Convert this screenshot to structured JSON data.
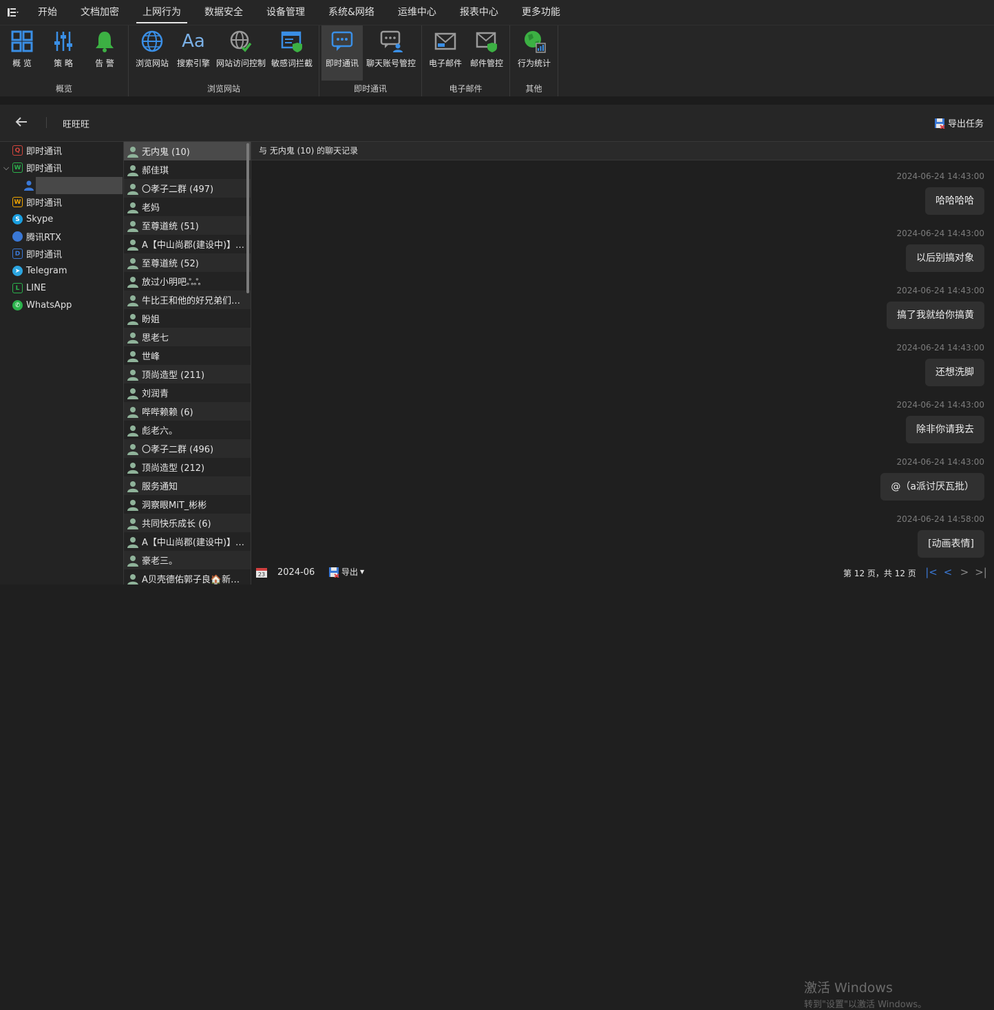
{
  "menubar": {
    "items": [
      "开始",
      "文档加密",
      "上网行为",
      "数据安全",
      "设备管理",
      "系统&网络",
      "运维中心",
      "报表中心",
      "更多功能"
    ],
    "active_index": 2
  },
  "ribbon": {
    "groups": [
      {
        "title": "概览",
        "buttons": [
          "概 览",
          "策 略",
          "告 警"
        ]
      },
      {
        "title": "浏览网站",
        "buttons": [
          "浏览网站",
          "搜索引擎",
          "网站访问控制",
          "敏感词拦截"
        ]
      },
      {
        "title": "即时通讯",
        "buttons": [
          "即时通讯",
          "聊天账号管控"
        ]
      },
      {
        "title": "电子邮件",
        "buttons": [
          "电子邮件",
          "邮件管控"
        ]
      },
      {
        "title": "其他",
        "buttons": [
          "行为统计"
        ]
      }
    ],
    "icon_glyph": "Aa"
  },
  "header": {
    "title": "旺旺旺",
    "export_task": "导出任务"
  },
  "nav": {
    "items": [
      {
        "label": "即时通讯",
        "icon": "im-red-icon",
        "color": "#d0453d",
        "glyph": "Q"
      },
      {
        "label": "即时通讯",
        "icon": "wechat-icon",
        "color": "#2bb24c",
        "glyph": "W",
        "expanded": true
      },
      {
        "label": "即时通讯",
        "icon": "wangwang-icon",
        "color": "#f0a500",
        "glyph": "W"
      },
      {
        "label": "Skype",
        "icon": "skype-icon",
        "color": "#1a9fe0",
        "glyph": "S"
      },
      {
        "label": "腾讯RTX",
        "icon": "rtx-icon",
        "color": "#3a78d6",
        "glyph": ""
      },
      {
        "label": "即时通讯",
        "icon": "dingtalk-icon",
        "color": "#3a78d6",
        "glyph": "D"
      },
      {
        "label": "Telegram",
        "icon": "telegram-icon",
        "color": "#2ca5e0",
        "glyph": "➤"
      },
      {
        "label": "LINE",
        "icon": "line-icon",
        "color": "#2bb24c",
        "glyph": "L"
      },
      {
        "label": "WhatsApp",
        "icon": "whatsapp-icon",
        "color": "#2bb24c",
        "glyph": "✆"
      }
    ],
    "expand_caret": "⌵"
  },
  "contacts": [
    "无内鬼 (10)",
    "郝佳琪",
    "〇孝子二群 (497)",
    "老妈",
    "至尊道统 (51)",
    "A【中山尚郡(建设中)】美...",
    "至尊道统 (52)",
    "放过小明吧ஃஃ",
    "牛比王和他的好兄弟们四群...",
    "盼姐",
    "思老七",
    "世峰",
    "顶尚造型 (211)",
    "刘润青",
    "哔哔赖赖 (6)",
    "彪老六。",
    "〇孝子二群 (496)",
    "顶尚造型 (212)",
    "服务通知",
    "洞察眼MiT_彬彬",
    "共同快乐成长 (6)",
    "A【中山尚郡(建设中)】美...",
    "豪老三。",
    "A贝壳德佑郭子良🏠新房二..."
  ],
  "chat": {
    "title": "与 无内鬼 (10) 的聊天记录",
    "messages": [
      {
        "time": "2024-06-24 14:43:00",
        "text": "哈哈哈哈"
      },
      {
        "time": "2024-06-24 14:43:00",
        "text": "以后别搞对象"
      },
      {
        "time": "2024-06-24 14:43:00",
        "text": "搞了我就给你搞黄"
      },
      {
        "time": "2024-06-24 14:43:00",
        "text": "还想洗脚"
      },
      {
        "time": "2024-06-24 14:43:00",
        "text": "除非你请我去"
      },
      {
        "time": "2024-06-24 14:43:00",
        "text": "@（a派讨厌瓦批）"
      },
      {
        "time": "2024-06-24 14:58:00",
        "text": "[动画表情]"
      }
    ]
  },
  "footer": {
    "calendar_day": "23",
    "date": "2024-06",
    "export": "导出",
    "page_info": "第 12 页，共 12 页",
    "pager": [
      "|<",
      "<",
      ">",
      ">|"
    ]
  },
  "watermark": {
    "line1": "激活 Windows",
    "line2": "转到\"设置\"以激活 Windows。"
  },
  "colors": {
    "accent_blue": "#3a78d6",
    "green": "#3cb043",
    "bg": "#1f1f1f"
  }
}
